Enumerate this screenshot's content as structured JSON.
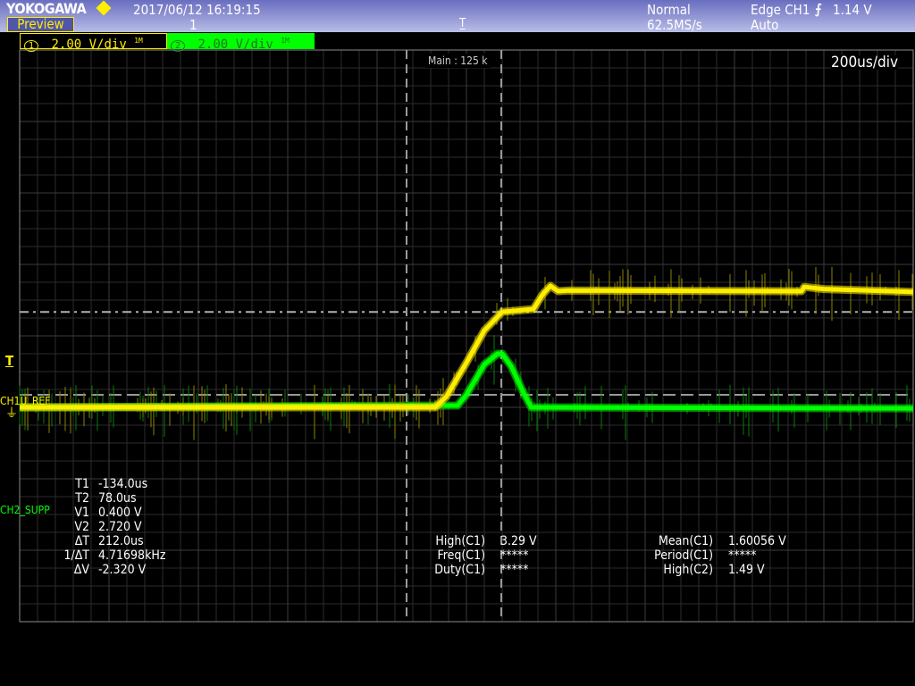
{
  "header": {
    "brand": "YOKOGAWA",
    "datetime": "2017/06/12 16:19:15",
    "mode_button": "Preview",
    "acq_count": "1",
    "acq_mode": "Normal",
    "sample_rate": "62.5MS/s",
    "trigger_type": "Edge CH1",
    "trigger_slope": "falling-edge-icon",
    "trigger_level": "1.14 V",
    "trigger_mode": "Auto"
  },
  "channels": [
    {
      "badge": "1",
      "scale": "2.00 V/div",
      "impedance": "1M",
      "color": "#ffee00"
    },
    {
      "badge": "2",
      "scale": "2.00 V/div",
      "impedance": "1M",
      "color": "#00ff00"
    }
  ],
  "screen": {
    "record_length": "Main : 125 k",
    "timebase": "200us/div",
    "trigger_marker": "T",
    "ch1_label": "CH1U_REF",
    "ch2_label": "CH2_SUPP"
  },
  "cursors": {
    "rows": [
      {
        "label": "T1",
        "value": "-134.0us"
      },
      {
        "label": "T2",
        "value": "78.0us"
      },
      {
        "label": "V1",
        "value": "0.400 V"
      },
      {
        "label": "V2",
        "value": "2.720 V"
      },
      {
        "label": "ΔT",
        "value": "212.0us"
      },
      {
        "label": "1/ΔT",
        "value": "4.71698kHz"
      },
      {
        "label": "ΔV",
        "value": "-2.320 V"
      }
    ]
  },
  "measurements": {
    "left": [
      {
        "label": "High(C1)",
        "value": "3.29 V"
      },
      {
        "label": "Freq(C1)",
        "value": "*****"
      },
      {
        "label": "Duty(C1)",
        "value": "*****"
      }
    ],
    "right": [
      {
        "label": "Mean(C1)",
        "value": "1.60056 V"
      },
      {
        "label": "Period(C1)",
        "value": "*****"
      },
      {
        "label": "High(C2)",
        "value": "1.49 V"
      }
    ]
  },
  "chart_data": {
    "type": "line",
    "xlabel": "",
    "ylabel": "",
    "x_unit": "us",
    "y_unit": "V",
    "xlim": [
      -1000,
      1000
    ],
    "ylim": [
      -5.95,
      10.05
    ],
    "x_divisions": 10,
    "y_divisions": 8,
    "grid": true,
    "cursor_t": [
      -134,
      78
    ],
    "cursor_v": [
      0.4,
      2.72
    ],
    "series": [
      {
        "name": "CH1U_REF",
        "color": "#ffee00",
        "points": [
          [
            -1000,
            0.05
          ],
          [
            -70,
            0.05
          ],
          [
            -45,
            0.35
          ],
          [
            0,
            1.3
          ],
          [
            40,
            2.2
          ],
          [
            80,
            2.72
          ],
          [
            150,
            2.8
          ],
          [
            170,
            3.2
          ],
          [
            188,
            3.45
          ],
          [
            205,
            3.3
          ],
          [
            230,
            3.32
          ],
          [
            750,
            3.3
          ],
          [
            756,
            3.42
          ],
          [
            800,
            3.36
          ],
          [
            1000,
            3.28
          ]
        ]
      },
      {
        "name": "CH2_SUPP",
        "color": "#00ff00",
        "points": [
          [
            -1000,
            0.05
          ],
          [
            -20,
            0.1
          ],
          [
            0,
            0.4
          ],
          [
            40,
            1.25
          ],
          [
            70,
            1.55
          ],
          [
            80,
            1.55
          ],
          [
            100,
            1.2
          ],
          [
            130,
            0.4
          ],
          [
            145,
            0.05
          ],
          [
            1000,
            0.02
          ]
        ]
      }
    ]
  }
}
